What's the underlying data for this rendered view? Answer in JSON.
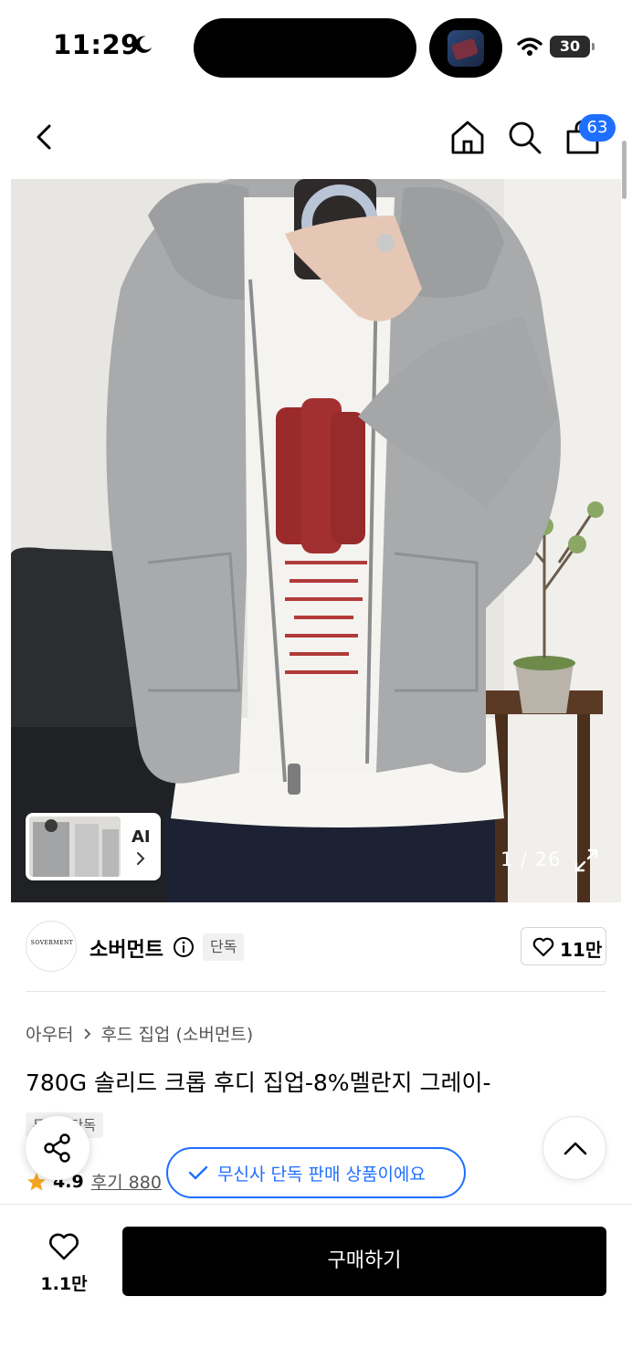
{
  "status_bar": {
    "time": "11:29",
    "battery": "30",
    "icons": [
      "moon-icon",
      "wifi-icon",
      "battery-icon"
    ]
  },
  "nav": {
    "cart_count": "63",
    "icons": [
      "back-icon",
      "home-icon",
      "search-icon",
      "cart-icon"
    ]
  },
  "gallery": {
    "ai_label": "AI",
    "counter": "1 / 26",
    "current_index": 1,
    "total": 26
  },
  "brand": {
    "logo_text": "SOVERMENT",
    "name": "소버먼트",
    "exclusive_tag": "단독",
    "likes": "11만"
  },
  "product": {
    "breadcrumb": [
      "아우터",
      "후드 집업 (소버먼트)"
    ],
    "title": "780G 솔리드 크롭 후디 집업-8%멜란지 그레이-",
    "tag": "무신사단독",
    "rating": "4.9",
    "review_label": "후기 880"
  },
  "toast": {
    "text": "무신사 단독 판매 상품이에요"
  },
  "purchase_bar": {
    "wish_count": "1.1만",
    "buy_label": "구매하기"
  },
  "colors": {
    "accent": "#1f6fff",
    "star": "#f5a623",
    "buy_button": "#000000"
  }
}
